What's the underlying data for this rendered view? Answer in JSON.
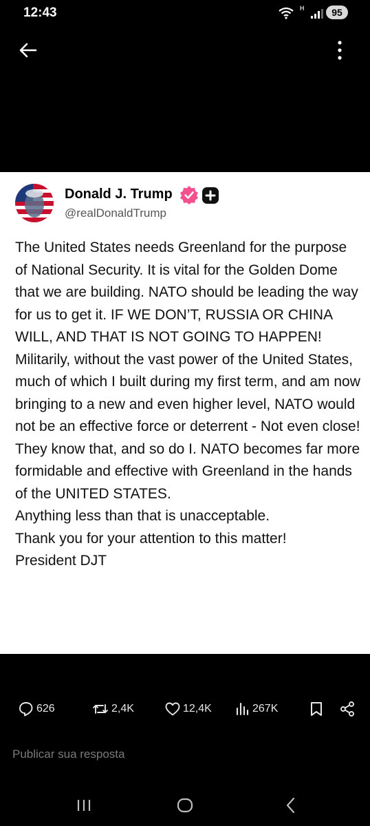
{
  "status_bar": {
    "time": "12:43",
    "network_type": "H",
    "battery": "95"
  },
  "icons": {
    "back": "back-arrow-icon",
    "more": "more-vertical-icon",
    "wifi": "wifi-icon",
    "signal": "signal-bars-icon",
    "verified": "verified-badge-icon",
    "plus": "plus-badge-icon",
    "reply": "reply-icon",
    "repost": "repost-icon",
    "like": "heart-icon",
    "views": "views-icon",
    "bookmark": "bookmark-icon",
    "share": "share-icon",
    "nav_recents": "recents-icon",
    "nav_home": "home-icon",
    "nav_back": "nav-back-icon"
  },
  "post": {
    "author_name": "Donald J. Trump",
    "author_handle": "@realDonaldTrump",
    "text": "The United States needs Greenland for the purpose of National Security. It is vital for the Golden Dome that we are building. NATO should be leading the way for us to get it. IF WE DON’T, RUSSIA OR CHINA WILL, AND THAT IS NOT GOING TO HAPPEN! Militarily, without the vast power of the United States, much of which I built during my first term, and am now bringing to a new and even higher level, NATO would not be an effective force or deterrent - Not even close! They know that, and so do I. NATO becomes far more formidable and effective with Greenland in the hands of the UNITED STATES.\nAnything less than that is unacceptable.\nThank you for your attention to this matter!\nPresident DJT"
  },
  "actions": {
    "replies": "626",
    "reposts": "2,4K",
    "likes": "12,4K",
    "views": "267K"
  },
  "reply": {
    "placeholder": "Publicar sua resposta"
  },
  "colors": {
    "verified_badge": "#f4508f",
    "background": "#000000",
    "card": "#ffffff"
  }
}
